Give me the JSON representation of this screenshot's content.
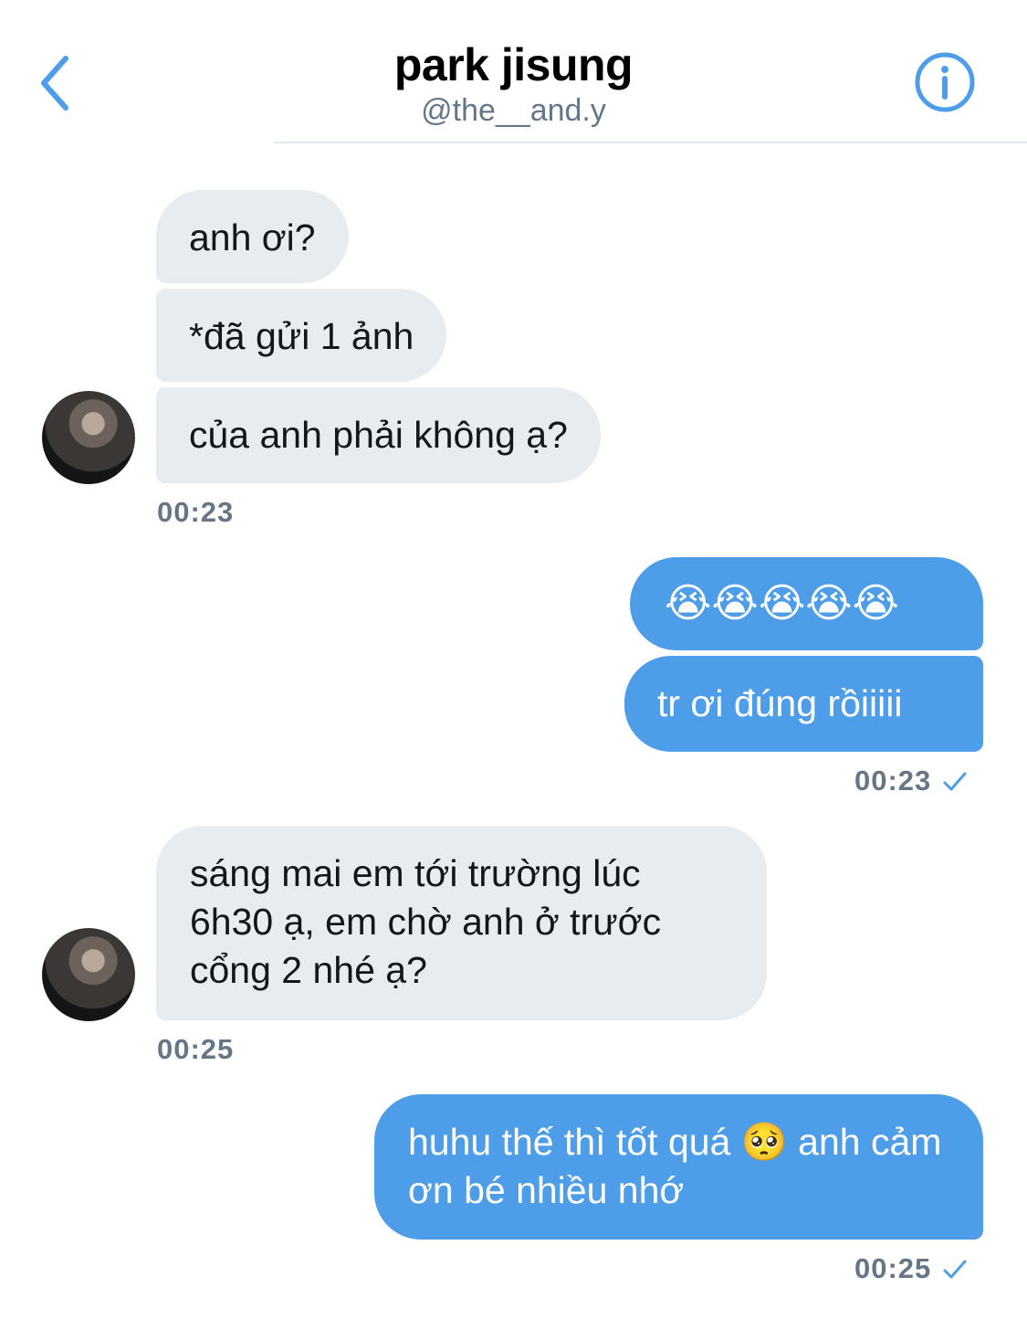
{
  "header": {
    "name": "park jisung",
    "handle": "@the__and.y",
    "colors": {
      "accent": "#4d9de8"
    }
  },
  "messages": [
    {
      "direction": "incoming",
      "text": "anh ơi?"
    },
    {
      "direction": "incoming",
      "text": "*đã gửi 1 ảnh"
    },
    {
      "direction": "incoming",
      "text": "của anh phải không ạ?"
    },
    {
      "direction": "timestamp-incoming",
      "text": "00:23"
    },
    {
      "direction": "outgoing",
      "text": "😭😭😭😭😭"
    },
    {
      "direction": "outgoing",
      "text": "tr ơi đúng rồiiiii"
    },
    {
      "direction": "timestamp-outgoing",
      "text": "00:23"
    },
    {
      "direction": "incoming",
      "text": "sáng mai em tới trường lúc 6h30 ạ, em chờ anh ở trước cổng 2 nhé ạ?"
    },
    {
      "direction": "timestamp-incoming",
      "text": "00:25"
    },
    {
      "direction": "outgoing",
      "text": "huhu thế thì tốt quá 🥺 anh cảm ơn bé nhiều nhớ"
    },
    {
      "direction": "timestamp-outgoing",
      "text": "00:25"
    }
  ],
  "colors": {
    "incoming_bubble": "#e6ecf0",
    "outgoing_bubble": "#4d9de8",
    "timestamp": "#657786"
  }
}
